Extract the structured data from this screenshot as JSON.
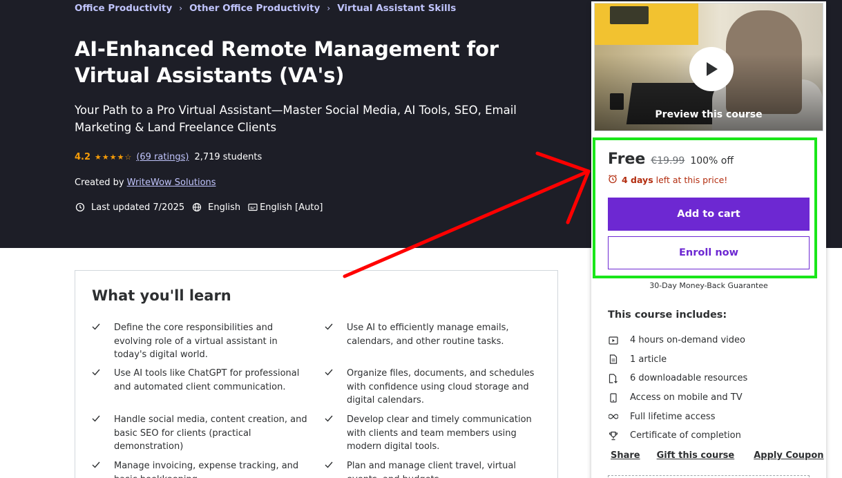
{
  "breadcrumb": [
    {
      "label": "Office Productivity"
    },
    {
      "label": "Other Office Productivity"
    },
    {
      "label": "Virtual Assistant Skills"
    }
  ],
  "course": {
    "title": "AI-Enhanced Remote Management for Virtual Assistants (VA's)",
    "subtitle": "Your Path to a Pro Virtual Assistant—Master Social Media, AI Tools, SEO, Email Marketing & Land Freelance Clients",
    "rating": "4.2",
    "stars": "★★★★☆",
    "ratings_count": "(69 ratings)",
    "students": "2,719 students",
    "created_prefix": "Created by",
    "author": "WriteWow Solutions",
    "last_updated": "Last updated 7/2025",
    "language": "English",
    "captions": "English [Auto]"
  },
  "sidebar": {
    "preview_label": "Preview this course",
    "price": "Free",
    "old_price": "€19.99",
    "discount": "100% off",
    "days_left": "4 days",
    "timer_suffix": "left at this price!",
    "add_to_cart": "Add to cart",
    "enroll_now": "Enroll now",
    "guarantee": "30-Day Money-Back Guarantee",
    "includes_title": "This course includes:",
    "includes": [
      {
        "icon": "video-icon",
        "label": "4 hours on-demand video"
      },
      {
        "icon": "article-icon",
        "label": "1 article"
      },
      {
        "icon": "download-icon",
        "label": "6 downloadable resources"
      },
      {
        "icon": "mobile-icon",
        "label": "Access on mobile and TV"
      },
      {
        "icon": "infinity-icon",
        "label": "Full lifetime access"
      },
      {
        "icon": "trophy-icon",
        "label": "Certificate of completion"
      }
    ],
    "share": "Share",
    "gift": "Gift this course",
    "coupon": "Apply Coupon"
  },
  "learn": {
    "title": "What you'll learn",
    "items": [
      "Define the core responsibilities and evolving role of a virtual assistant in today's digital world.",
      "Use AI to efficiently manage emails, calendars, and other routine tasks.",
      "Use AI tools like ChatGPT for professional and automated client communication.",
      "Organize files, documents, and schedules with confidence using cloud storage and digital calendars.",
      "Handle social media, content creation, and basic SEO for clients (practical demonstration)",
      "Develop clear and timely communication with clients and team members using modern digital tools.",
      "Manage invoicing, expense tracking, and basic bookkeeping",
      "Plan and manage client travel, virtual events, and budgets"
    ]
  },
  "colors": {
    "hero_bg": "#1d1e27",
    "accent": "#6d28d2",
    "link": "#c0c4fc",
    "star": "#f69c08",
    "alert": "#b32d0f",
    "highlight": "#19e619",
    "arrow": "#ff0000"
  }
}
